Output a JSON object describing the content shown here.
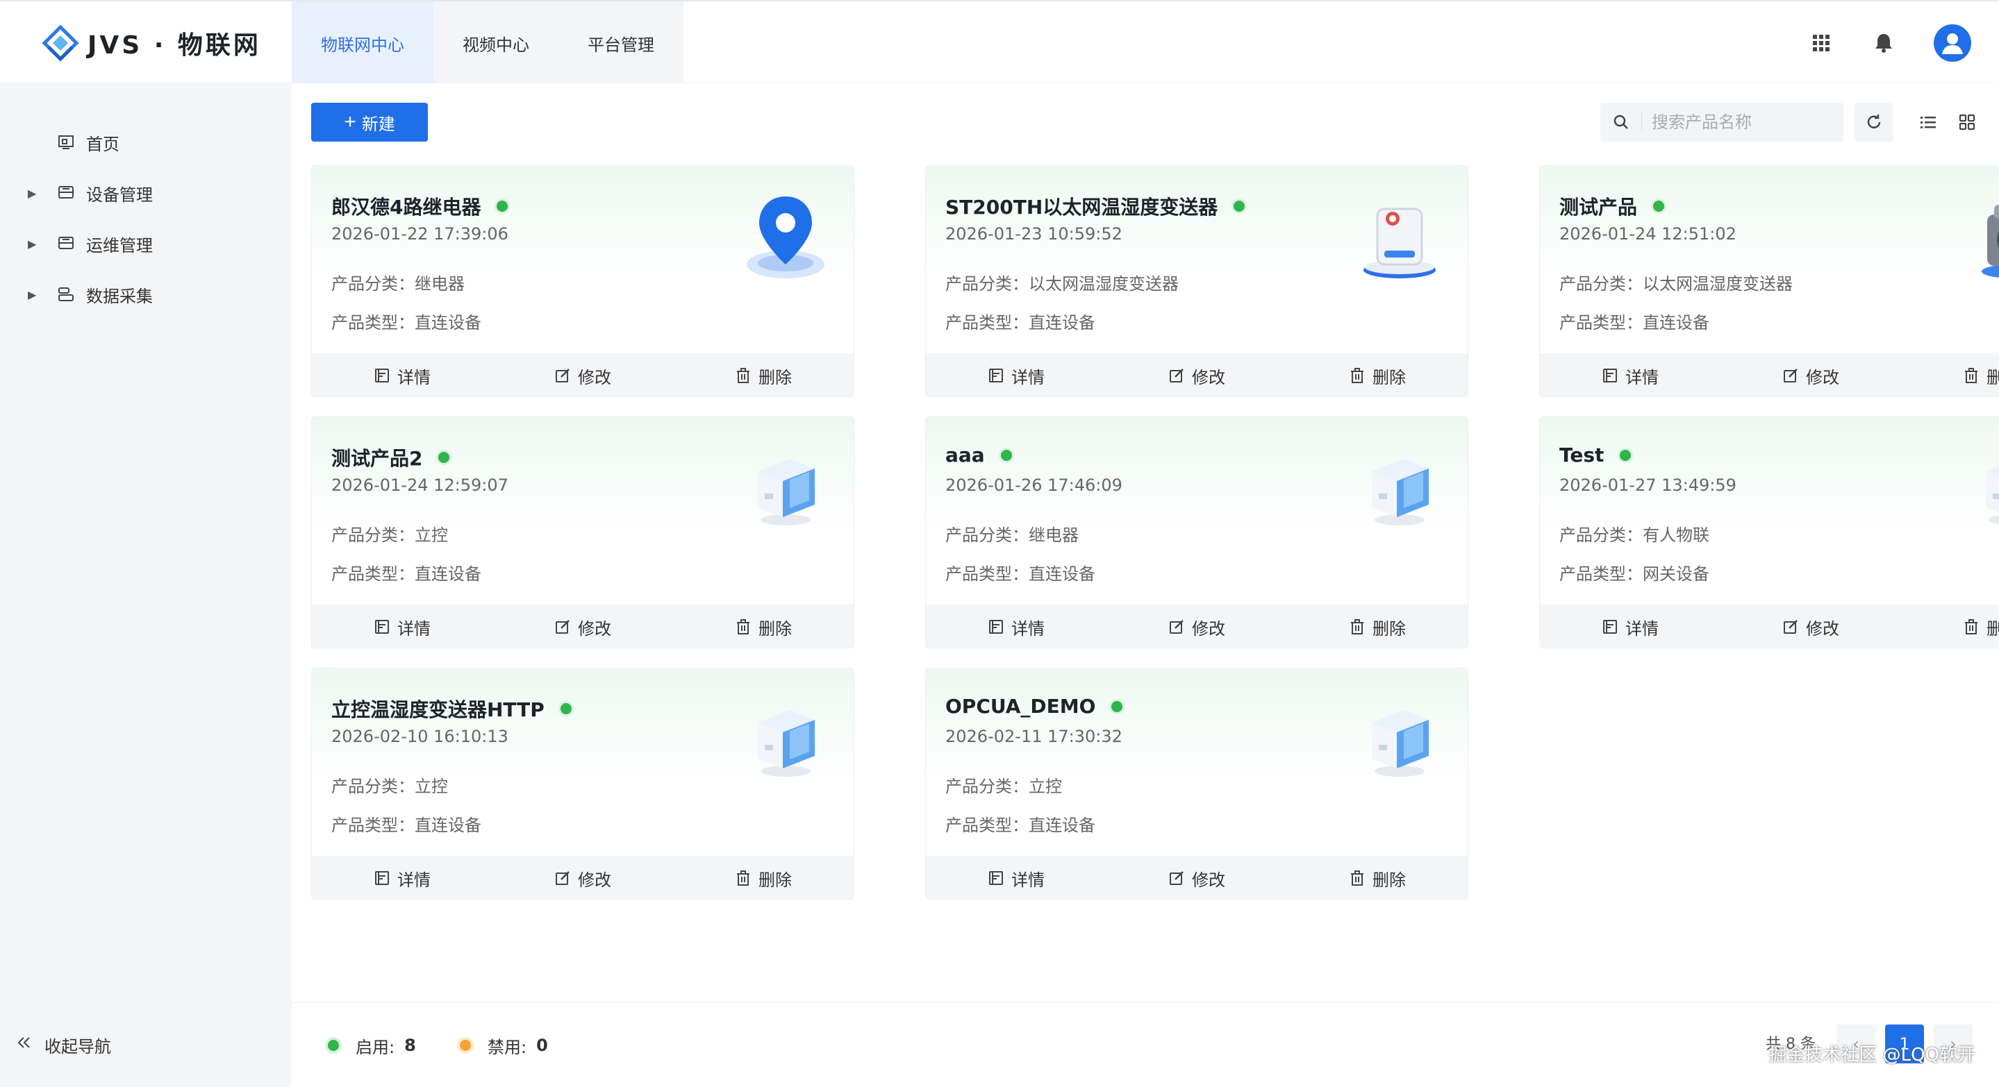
{
  "header": {
    "logo_text": "JVS · 物联网",
    "tabs": [
      {
        "label": "物联网中心",
        "active": true
      },
      {
        "label": "视频中心",
        "active": false
      },
      {
        "label": "平台管理",
        "active": false
      }
    ],
    "icons": [
      "grid-apps-icon",
      "bell-icon",
      "user-avatar-icon"
    ]
  },
  "sidebar": {
    "items": [
      {
        "label": "首页",
        "icon": "home-icon",
        "expandable": false
      },
      {
        "label": "设备管理",
        "icon": "device-icon",
        "expandable": true
      },
      {
        "label": "运维管理",
        "icon": "maintenance-icon",
        "expandable": true
      },
      {
        "label": "数据采集",
        "icon": "data-icon",
        "expandable": true
      }
    ],
    "collapse_label": "收起导航"
  },
  "toolbar": {
    "new_label": "新建",
    "search_placeholder": "搜索产品名称"
  },
  "card_labels": {
    "category_prefix": "产品分类：",
    "type_prefix": "产品类型：",
    "detail": "详情",
    "edit": "修改",
    "delete": "删除"
  },
  "products": [
    {
      "name": "郎汉德4路继电器",
      "time": "2026-01-22 17:39:06",
      "category": "继电器",
      "type": "直连设备",
      "image": "location-pin",
      "enabled": true
    },
    {
      "name": "ST200TH以太网温湿度变送器",
      "time": "2026-01-23 10:59:52",
      "category": "以太网温湿度变送器",
      "type": "直连设备",
      "image": "sensor-device",
      "enabled": true
    },
    {
      "name": "测试产品",
      "time": "2026-01-24 12:51:02",
      "category": "以太网温湿度变送器",
      "type": "直连设备",
      "image": "camera-device",
      "enabled": true
    },
    {
      "name": "测试产品2",
      "time": "2026-01-24 12:59:07",
      "category": "立控",
      "type": "直连设备",
      "image": "cube-device",
      "enabled": true
    },
    {
      "name": "aaa",
      "time": "2026-01-26 17:46:09",
      "category": "继电器",
      "type": "直连设备",
      "image": "cube-device",
      "enabled": true
    },
    {
      "name": "Test",
      "time": "2026-01-27 13:49:59",
      "category": "有人物联",
      "type": "网关设备",
      "image": "cube-device",
      "enabled": true
    },
    {
      "name": "立控温湿度变送器HTTP",
      "time": "2026-02-10 16:10:13",
      "category": "立控",
      "type": "直连设备",
      "image": "cube-device",
      "enabled": true
    },
    {
      "name": "OPCUA_DEMO",
      "time": "2026-02-11 17:30:32",
      "category": "立控",
      "type": "直连设备",
      "image": "cube-device",
      "enabled": true
    }
  ],
  "footer": {
    "enabled_label": "启用:",
    "enabled_count": "8",
    "disabled_label": "禁用:",
    "disabled_count": "0",
    "total_text": "共 8 条",
    "current_page": "1",
    "watermark": "掘金技术社区 @LQQ软开"
  },
  "colors": {
    "primary": "#1f6fe8",
    "enabled": "#2fb54a",
    "disabled": "#f7a234",
    "sidebar_bg": "#f4f5f7"
  }
}
